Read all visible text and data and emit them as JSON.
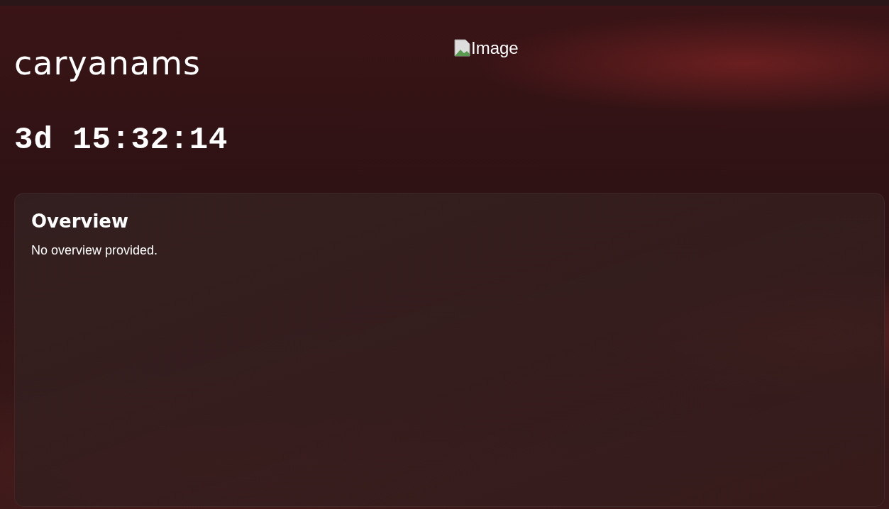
{
  "profile": {
    "name": "caryanams",
    "countdown": "3d 15:32:14",
    "image_alt": "Image"
  },
  "overview": {
    "title": "Overview",
    "text": "No overview provided."
  }
}
